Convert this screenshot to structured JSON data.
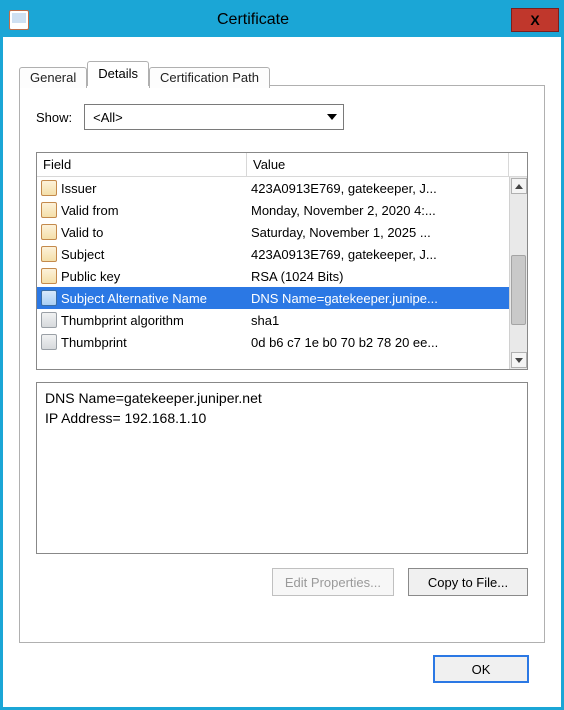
{
  "window": {
    "title": "Certificate",
    "close_label": "X"
  },
  "tabs": {
    "general": "General",
    "details": "Details",
    "cert_path": "Certification Path",
    "active": "details"
  },
  "show": {
    "label": "Show:",
    "selected": "<All>"
  },
  "fields": {
    "header_field": "Field",
    "header_value": "Value",
    "rows": [
      {
        "field": "Issuer",
        "value": "423A0913E769, gatekeeper, J...",
        "icon": "cert",
        "selected": false
      },
      {
        "field": "Valid from",
        "value": "Monday, November 2, 2020 4:...",
        "icon": "cert",
        "selected": false
      },
      {
        "field": "Valid to",
        "value": "Saturday, November 1, 2025 ...",
        "icon": "cert",
        "selected": false
      },
      {
        "field": "Subject",
        "value": "423A0913E769, gatekeeper, J...",
        "icon": "cert",
        "selected": false
      },
      {
        "field": "Public key",
        "value": "RSA (1024 Bits)",
        "icon": "cert",
        "selected": false
      },
      {
        "field": "Subject Alternative Name",
        "value": "DNS Name=gatekeeper.junipe...",
        "icon": "blue",
        "selected": true
      },
      {
        "field": "Thumbprint algorithm",
        "value": "sha1",
        "icon": "gray",
        "selected": false
      },
      {
        "field": "Thumbprint",
        "value": "0d b6 c7 1e b0 70 b2 78 20 ee...",
        "icon": "gray",
        "selected": false
      }
    ]
  },
  "detail": {
    "text": "DNS Name=gatekeeper.juniper.net\nIP Address=  192.168.1.10"
  },
  "buttons": {
    "edit_properties": "Edit Properties...",
    "copy_to_file": "Copy to File...",
    "ok": "OK"
  }
}
